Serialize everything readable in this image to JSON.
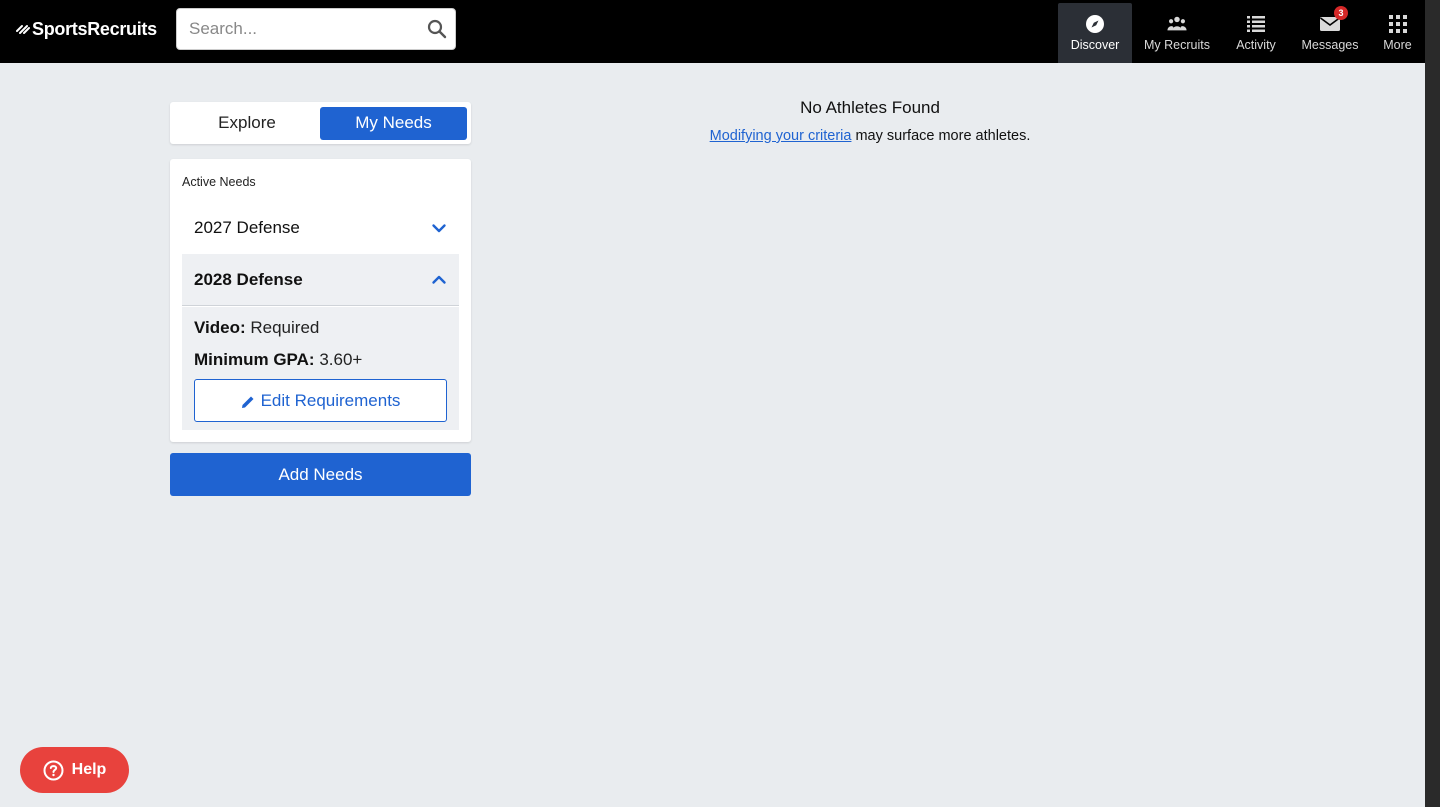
{
  "topbar": {
    "logo_text": "SportsRecruits",
    "search": {
      "placeholder": "Search...",
      "value": ""
    },
    "nav": [
      {
        "label": "Discover",
        "icon": "compass-icon",
        "active": true
      },
      {
        "label": "My Recruits",
        "icon": "people-icon",
        "active": false
      },
      {
        "label": "Activity",
        "icon": "list-icon",
        "active": false
      },
      {
        "label": "Messages",
        "icon": "envelope-icon",
        "active": false,
        "badge": "3"
      },
      {
        "label": "More",
        "icon": "grid-icon",
        "active": false
      }
    ]
  },
  "sidebar": {
    "tabs": {
      "explore": "Explore",
      "my_needs": "My Needs"
    },
    "active_needs_label": "Active Needs",
    "needs": [
      {
        "title": "2027 Defense",
        "expanded": false
      },
      {
        "title": "2028 Defense",
        "expanded": true
      }
    ],
    "details": {
      "video_label": "Video:",
      "video_value": "Required",
      "gpa_label": "Minimum GPA:",
      "gpa_value": "3.60+"
    },
    "edit_button": "Edit Requirements",
    "add_button": "Add Needs"
  },
  "results": {
    "empty_title": "No Athletes Found",
    "empty_link": "Modifying your criteria",
    "empty_rest": " may surface more athletes."
  },
  "help": {
    "label": "Help"
  },
  "colors": {
    "accent": "#1f63d1",
    "topbar_bg": "#000000",
    "page_bg": "#e9ecef",
    "help_bg": "#e8423d",
    "badge_bg": "#d62828"
  }
}
